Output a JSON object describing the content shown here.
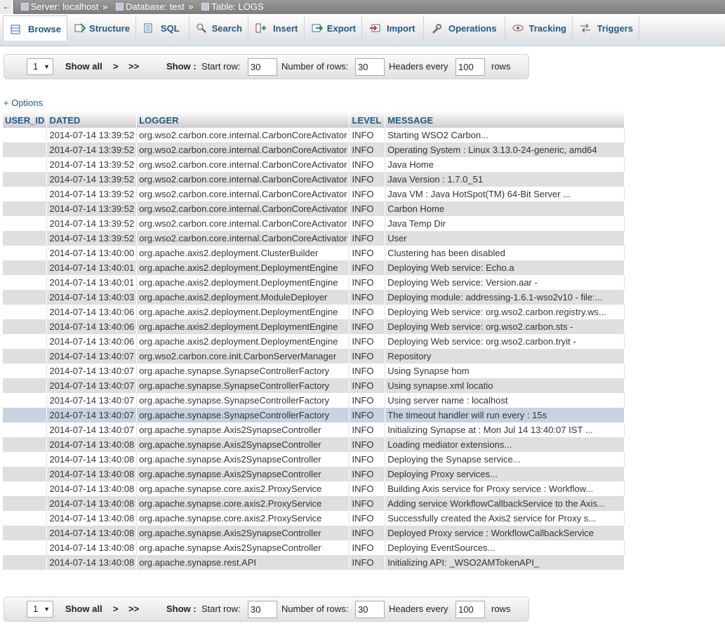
{
  "breadcrumb": {
    "back": "←",
    "server": "Server: localhost",
    "database": "Database: test",
    "table": "Table: LOGS",
    "sep": "»"
  },
  "tabs": [
    {
      "label": "Browse",
      "icon": "browse-icon"
    },
    {
      "label": "Structure",
      "icon": "structure-icon"
    },
    {
      "label": "SQL",
      "icon": "sql-icon"
    },
    {
      "label": "Search",
      "icon": "search-icon"
    },
    {
      "label": "Insert",
      "icon": "insert-icon"
    },
    {
      "label": "Export",
      "icon": "export-icon"
    },
    {
      "label": "Import",
      "icon": "import-icon"
    },
    {
      "label": "Operations",
      "icon": "wrench-icon"
    },
    {
      "label": "Tracking",
      "icon": "eye-icon"
    },
    {
      "label": "Triggers",
      "icon": "triggers-icon"
    }
  ],
  "nav": {
    "page": "1",
    "show_all": "Show all",
    "next": ">",
    "last": ">>",
    "show_label": "Show :",
    "start_row_label": "Start row:",
    "start_row": "30",
    "num_rows_label": "Number of rows:",
    "num_rows": "30",
    "headers_label": "Headers every",
    "headers_every": "100",
    "rows_label": "rows"
  },
  "options_link": "+ Options",
  "table": {
    "columns": [
      "USER_ID",
      "DATED",
      "LOGGER",
      "LEVEL",
      "MESSAGE"
    ],
    "rows": [
      [
        "",
        "2014-07-14 13:39:52",
        "org.wso2.carbon.core.internal.CarbonCoreActivator",
        "INFO",
        "Starting WSO2 Carbon..."
      ],
      [
        "",
        "2014-07-14 13:39:52",
        "org.wso2.carbon.core.internal.CarbonCoreActivator",
        "INFO",
        "Operating System : Linux 3.13.0-24-generic, amd64"
      ],
      [
        "",
        "2014-07-14 13:39:52",
        "org.wso2.carbon.core.internal.CarbonCoreActivator",
        "INFO",
        "Java Home"
      ],
      [
        "",
        "2014-07-14 13:39:52",
        "org.wso2.carbon.core.internal.CarbonCoreActivator",
        "INFO",
        "Java Version      : 1.7.0_51"
      ],
      [
        "",
        "2014-07-14 13:39:52",
        "org.wso2.carbon.core.internal.CarbonCoreActivator",
        "INFO",
        "Java VM           : Java HotSpot(TM) 64-Bit Server ..."
      ],
      [
        "",
        "2014-07-14 13:39:52",
        "org.wso2.carbon.core.internal.CarbonCoreActivator",
        "INFO",
        "Carbon Home"
      ],
      [
        "",
        "2014-07-14 13:39:52",
        "org.wso2.carbon.core.internal.CarbonCoreActivator",
        "INFO",
        "Java Temp Dir"
      ],
      [
        "",
        "2014-07-14 13:39:52",
        "org.wso2.carbon.core.internal.CarbonCoreActivator",
        "INFO",
        "User"
      ],
      [
        "",
        "2014-07-14 13:40:00",
        "org.apache.axis2.deployment.ClusterBuilder",
        "INFO",
        "Clustering has been disabled"
      ],
      [
        "",
        "2014-07-14 13:40:01",
        "org.apache.axis2.deployment.DeploymentEngine",
        "INFO",
        "Deploying Web service: Echo.a"
      ],
      [
        "",
        "2014-07-14 13:40:01",
        "org.apache.axis2.deployment.DeploymentEngine",
        "INFO",
        "Deploying Web service: Version.aar -"
      ],
      [
        "",
        "2014-07-14 13:40:03",
        "org.apache.axis2.deployment.ModuleDeployer",
        "INFO",
        "Deploying module: addressing-1.6.1-wso2v10 - file:..."
      ],
      [
        "",
        "2014-07-14 13:40:06",
        "org.apache.axis2.deployment.DeploymentEngine",
        "INFO",
        "Deploying Web service: org.wso2.carbon.registry.ws..."
      ],
      [
        "",
        "2014-07-14 13:40:06",
        "org.apache.axis2.deployment.DeploymentEngine",
        "INFO",
        "Deploying Web service: org.wso2.carbon.sts -"
      ],
      [
        "",
        "2014-07-14 13:40:06",
        "org.apache.axis2.deployment.DeploymentEngine",
        "INFO",
        "Deploying Web service: org.wso2.carbon.tryit -"
      ],
      [
        "",
        "2014-07-14 13:40:07",
        "org.wso2.carbon.core.init.CarbonServerManager",
        "INFO",
        "Repository"
      ],
      [
        "",
        "2014-07-14 13:40:07",
        "org.apache.synapse.SynapseControllerFactory",
        "INFO",
        "Using Synapse hom"
      ],
      [
        "",
        "2014-07-14 13:40:07",
        "org.apache.synapse.SynapseControllerFactory",
        "INFO",
        "Using synapse.xml locatio"
      ],
      [
        "",
        "2014-07-14 13:40:07",
        "org.apache.synapse.SynapseControllerFactory",
        "INFO",
        "Using server name : localhost"
      ],
      [
        "",
        "2014-07-14 13:40:07",
        "org.apache.synapse.SynapseControllerFactory",
        "INFO",
        "The timeout handler will run every : 15s"
      ],
      [
        "",
        "2014-07-14 13:40:07",
        "org.apache.synapse.Axis2SynapseController",
        "INFO",
        "Initializing Synapse at : Mon Jul 14 13:40:07 IST ..."
      ],
      [
        "",
        "2014-07-14 13:40:08",
        "org.apache.synapse.Axis2SynapseController",
        "INFO",
        "Loading mediator extensions..."
      ],
      [
        "",
        "2014-07-14 13:40:08",
        "org.apache.synapse.Axis2SynapseController",
        "INFO",
        "Deploying the Synapse service..."
      ],
      [
        "",
        "2014-07-14 13:40:08",
        "org.apache.synapse.Axis2SynapseController",
        "INFO",
        "Deploying Proxy services..."
      ],
      [
        "",
        "2014-07-14 13:40:08",
        "org.apache.synapse.core.axis2.ProxyService",
        "INFO",
        "Building Axis service for Proxy service : Workflow..."
      ],
      [
        "",
        "2014-07-14 13:40:08",
        "org.apache.synapse.core.axis2.ProxyService",
        "INFO",
        "Adding service WorkflowCallbackService to the Axis..."
      ],
      [
        "",
        "2014-07-14 13:40:08",
        "org.apache.synapse.core.axis2.ProxyService",
        "INFO",
        "Successfully created the Axis2 service for Proxy s..."
      ],
      [
        "",
        "2014-07-14 13:40:08",
        "org.apache.synapse.Axis2SynapseController",
        "INFO",
        "Deployed Proxy service : WorkflowCallbackService"
      ],
      [
        "",
        "2014-07-14 13:40:08",
        "org.apache.synapse.Axis2SynapseController",
        "INFO",
        "Deploying EventSources..."
      ],
      [
        "",
        "2014-07-14 13:40:08",
        "org.apache.synapse.rest.API",
        "INFO",
        "Initializing API: _WSO2AMTokenAPI_"
      ]
    ],
    "marked_row": 19
  },
  "colors": {
    "accent": "#235a81",
    "marked_row": "#c7d3e1",
    "even_row": "#dfdfdf"
  }
}
